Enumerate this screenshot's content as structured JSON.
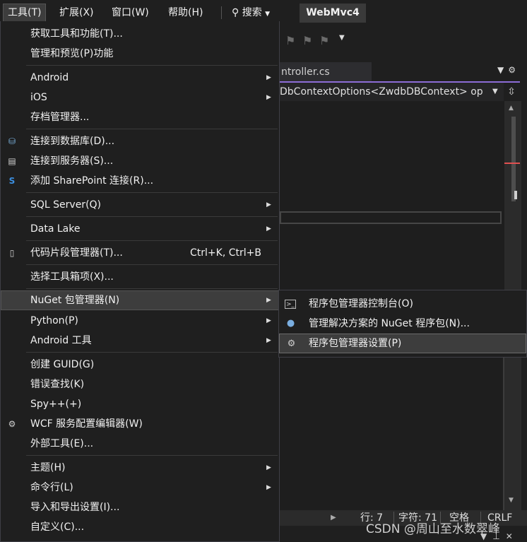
{
  "menubar": {
    "items": [
      "工具(T)",
      "扩展(X)",
      "窗口(W)",
      "帮助(H)"
    ],
    "search_label": "搜索",
    "solution_title": "WebMvc4"
  },
  "editor": {
    "tab_label": "ntroller.cs",
    "navbar_text": "DbContextOptions<ZwdbDBContext> op"
  },
  "status": {
    "line": "行: 7",
    "char": "字符: 71",
    "space": "空格",
    "eol": "CRLF"
  },
  "watermark": "CSDN @周山至水数翠峰",
  "tools_menu": {
    "items": [
      {
        "label": "获取工具和功能(T)..."
      },
      {
        "label": "管理和预览(P)功能"
      },
      {
        "label": "Android"
      },
      {
        "label": "iOS"
      },
      {
        "label": "存档管理器..."
      },
      {
        "label": "连接到数据库(D)...",
        "icon": "database-connect-icon"
      },
      {
        "label": "连接到服务器(S)...",
        "icon": "server-connect-icon"
      },
      {
        "label": "添加 SharePoint 连接(R)...",
        "icon": "sharepoint-icon"
      },
      {
        "label": "SQL Server(Q)"
      },
      {
        "label": "Data Lake"
      },
      {
        "label": "代码片段管理器(T)...",
        "shortcut": "Ctrl+K, Ctrl+B",
        "icon": "code-snippet-icon"
      },
      {
        "label": "选择工具箱项(X)..."
      },
      {
        "label": "NuGet 包管理器(N)"
      },
      {
        "label": "Python(P)"
      },
      {
        "label": "Android 工具"
      },
      {
        "label": "创建 GUID(G)"
      },
      {
        "label": "错误查找(K)"
      },
      {
        "label": "Spy++(+)"
      },
      {
        "label": "WCF 服务配置编辑器(W)",
        "icon": "wcf-config-icon"
      },
      {
        "label": "外部工具(E)..."
      },
      {
        "label": "主题(H)"
      },
      {
        "label": "命令行(L)"
      },
      {
        "label": "导入和导出设置(I)..."
      },
      {
        "label": "自定义(C)..."
      }
    ]
  },
  "nuget_menu": {
    "items": [
      {
        "label": "程序包管理器控制台(O)",
        "icon": "console-icon"
      },
      {
        "label": "管理解决方案的 NuGet 程序包(N)...",
        "icon": "nuget-package-icon"
      },
      {
        "label": "程序包管理器设置(P)",
        "icon": "gear-icon"
      }
    ]
  }
}
